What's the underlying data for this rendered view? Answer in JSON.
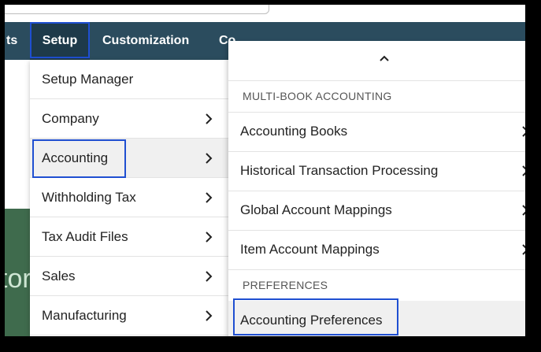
{
  "nav": {
    "partial_left": "ts",
    "setup": "Setup",
    "customization": "Customization",
    "partial_right": "Co"
  },
  "menu_level1": {
    "items": [
      {
        "label": "Setup Manager",
        "has_submenu": false
      },
      {
        "label": "Company",
        "has_submenu": true
      },
      {
        "label": "Accounting",
        "has_submenu": true,
        "active": true
      },
      {
        "label": "Withholding Tax",
        "has_submenu": true
      },
      {
        "label": "Tax Audit Files",
        "has_submenu": true
      },
      {
        "label": "Sales",
        "has_submenu": true
      },
      {
        "label": "Manufacturing",
        "has_submenu": true
      }
    ]
  },
  "menu_level2": {
    "scroll_up_icon": "chevron-up-icon",
    "sections": [
      {
        "header": "MULTI-BOOK ACCOUNTING",
        "items": [
          {
            "label": "Accounting Books"
          },
          {
            "label": "Historical Transaction Processing"
          },
          {
            "label": "Global Account Mappings"
          },
          {
            "label": "Item Account Mappings"
          }
        ]
      },
      {
        "header": "PREFERENCES",
        "items": [
          {
            "label": "Accounting Preferences",
            "active": true
          }
        ]
      }
    ]
  },
  "background_text": "tor",
  "colors": {
    "navbar": "#2b4c5e",
    "highlight_border": "#1f4fd1",
    "active_item_bg": "#f0f0f0"
  }
}
